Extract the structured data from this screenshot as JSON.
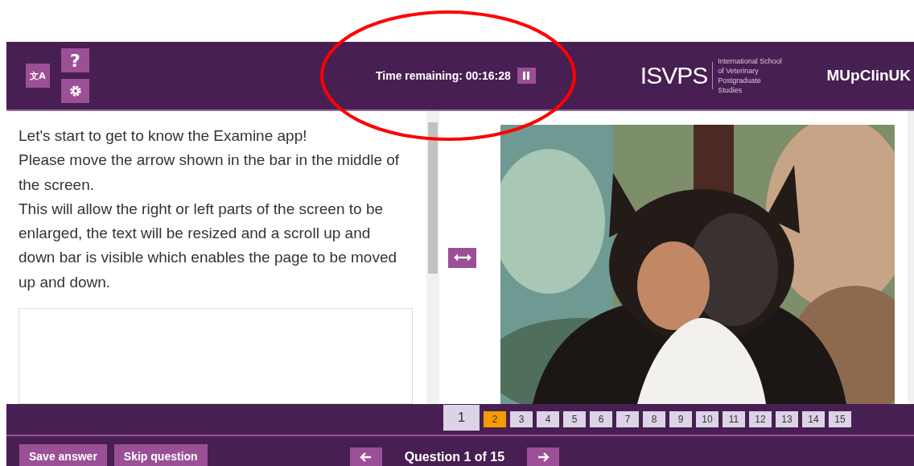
{
  "header": {
    "tool_buttons": [
      {
        "kind": "translate",
        "label": "文A"
      },
      {
        "kind": "help",
        "label": "?"
      },
      {
        "kind": "settings"
      }
    ],
    "timer": {
      "label": "Time remaining: 00:16:28",
      "paused": false
    },
    "logo": {
      "mark": "ISVPS",
      "lines": [
        "International School",
        "of Veterinary",
        "Postgraduate",
        "Studies"
      ]
    },
    "course": "MUpClinUK"
  },
  "question": {
    "paragraphs": [
      "Let's start to get to know the Examine app!",
      "Please move the arrow shown in the bar in the middle of the screen.",
      "This will allow the right or left parts of the screen to be enlarged, the text will be resized and a scroll up and down bar is visible which enables the page to be moved up and down."
    ]
  },
  "pager": [
    {
      "label": "1",
      "selected": true,
      "color": "#ddd3e6"
    },
    {
      "label": "2",
      "selected": false,
      "color": "#f59b00"
    },
    {
      "label": "3",
      "selected": false,
      "color": "#ddd3e6"
    },
    {
      "label": "4",
      "selected": false,
      "color": "#ddd3e6"
    },
    {
      "label": "5",
      "selected": false,
      "color": "#ddd3e6"
    },
    {
      "label": "6",
      "selected": false,
      "color": "#ddd3e6"
    },
    {
      "label": "7",
      "selected": false,
      "color": "#ddd3e6"
    },
    {
      "label": "8",
      "selected": false,
      "color": "#ddd3e6"
    },
    {
      "label": "9",
      "selected": false,
      "color": "#ddd3e6"
    },
    {
      "label": "10",
      "selected": false,
      "color": "#ddd3e6"
    },
    {
      "label": "11",
      "selected": false,
      "color": "#ddd3e6"
    },
    {
      "label": "12",
      "selected": false,
      "color": "#ddd3e6"
    },
    {
      "label": "13",
      "selected": false,
      "color": "#ddd3e6"
    },
    {
      "label": "14",
      "selected": false,
      "color": "#ddd3e6"
    },
    {
      "label": "15",
      "selected": false,
      "color": "#ddd3e6"
    }
  ],
  "footer": {
    "actions": [
      "Save answer",
      "Skip question"
    ],
    "position": "Question 1 of 15"
  },
  "annotation": {
    "kind": "ellipse"
  }
}
